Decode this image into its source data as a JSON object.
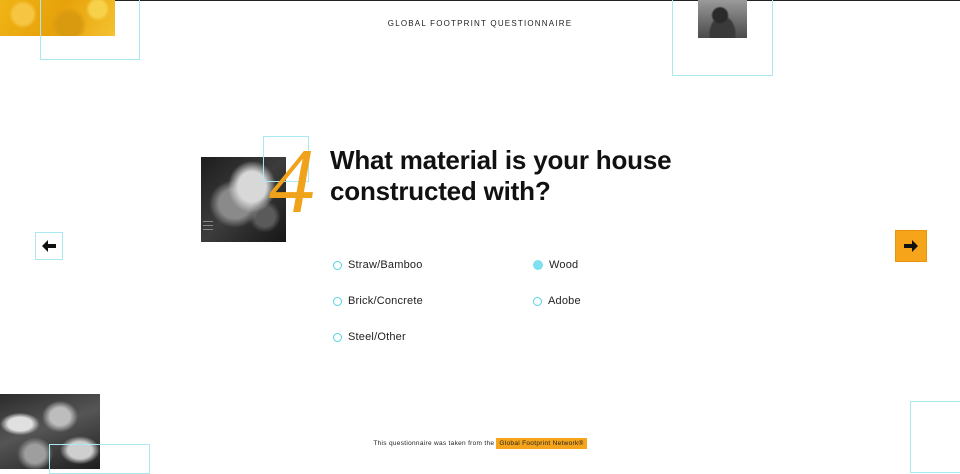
{
  "header": {
    "title": "GLOBAL FOOTPRINT QUESTIONNAIRE"
  },
  "question": {
    "number": "4",
    "text": "What material is your house constructed with?"
  },
  "options": [
    {
      "label": "Straw/Bamboo",
      "selected": false
    },
    {
      "label": "Brick/Concrete",
      "selected": false
    },
    {
      "label": "Steel/Other",
      "selected": false
    },
    {
      "label": "Wood",
      "selected": true
    },
    {
      "label": "Adobe",
      "selected": false
    }
  ],
  "navigation": {
    "prev_icon": "arrow-left-icon",
    "next_icon": "arrow-right-icon"
  },
  "footer": {
    "text": "This questionnaire was taken from the",
    "link_label": "Global Footprint Network®"
  },
  "colors": {
    "accent_orange": "#f6a51b",
    "accent_cyan": "#7fe0ef",
    "text": "#111111"
  }
}
